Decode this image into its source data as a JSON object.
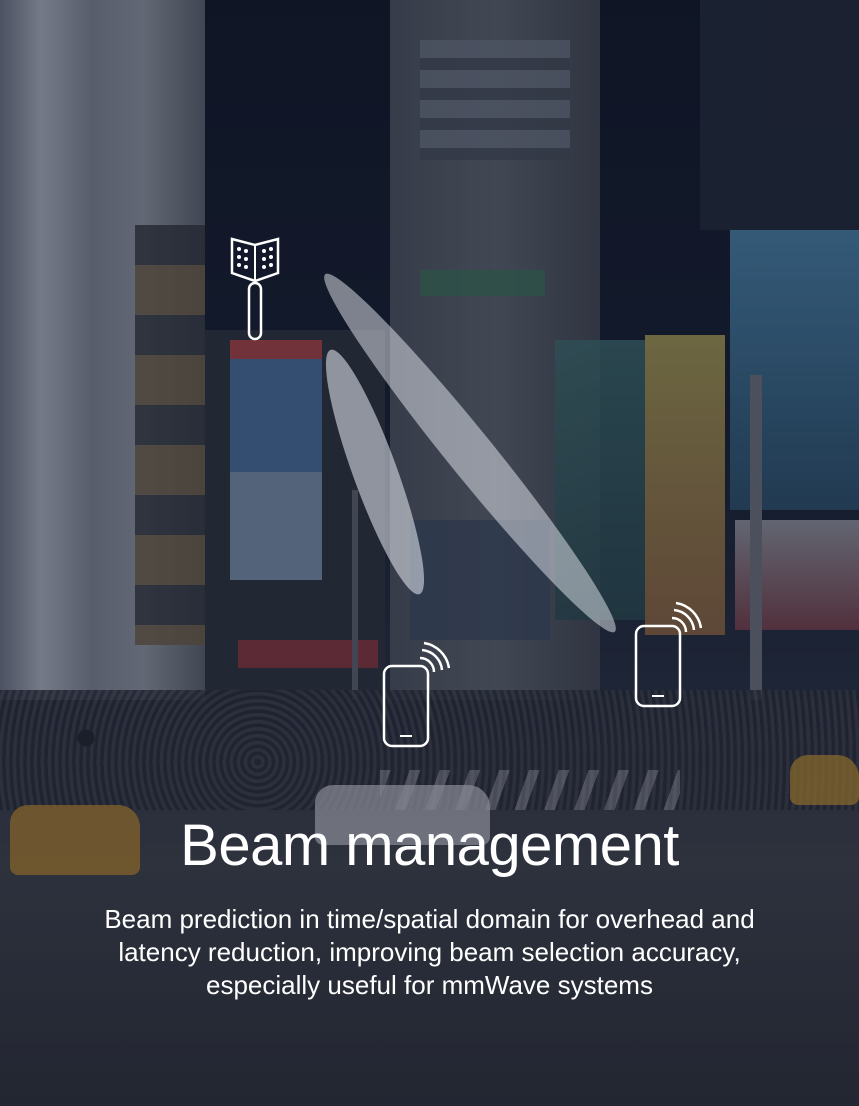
{
  "heading": {
    "title": "Beam management",
    "description": "Beam prediction in time/spatial domain for overhead and latency reduction, improving beam selection accuracy, especially useful for mmWave systems"
  },
  "graphics": {
    "antenna": "antenna-array-icon",
    "devices": [
      "smartphone-signal-icon",
      "smartphone-signal-icon"
    ],
    "beams": 2
  },
  "colors": {
    "text": "#ffffff",
    "overlay": "#141a2a",
    "beam": "#ebeef5"
  }
}
